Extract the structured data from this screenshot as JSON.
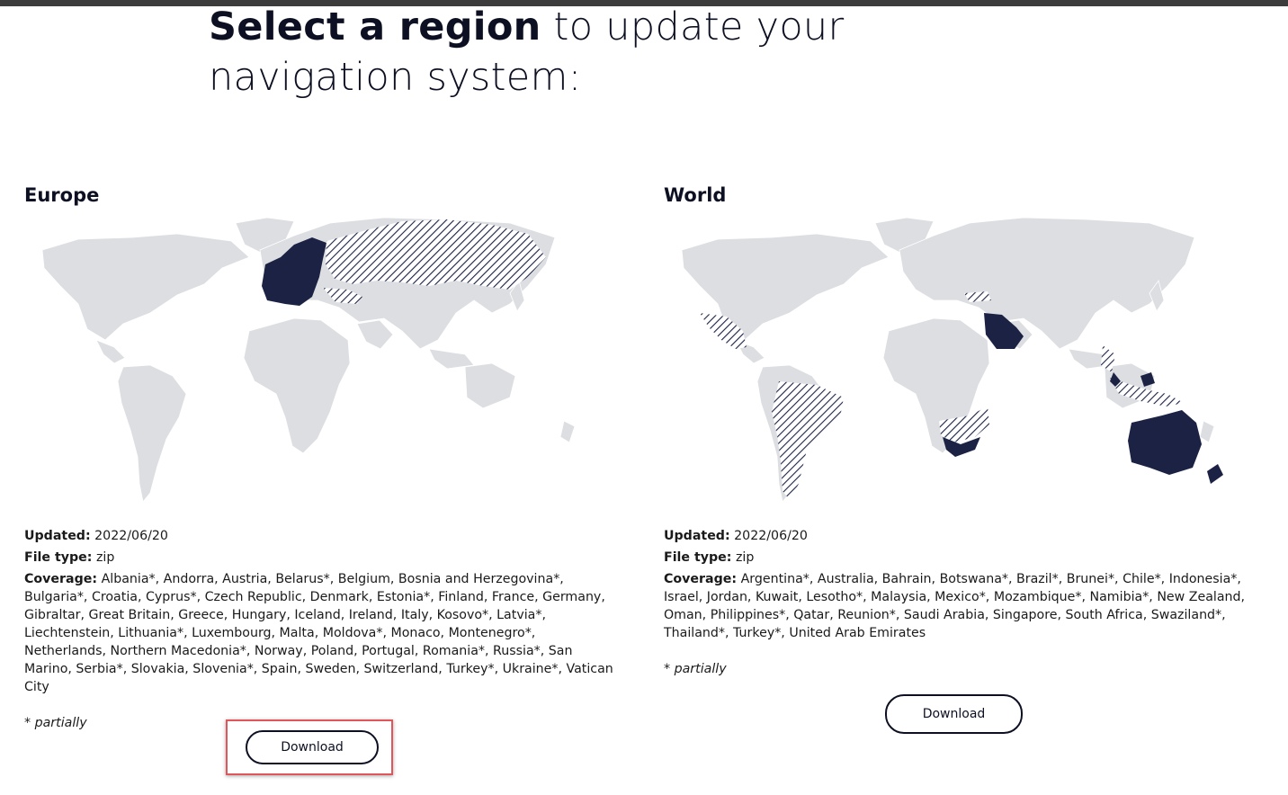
{
  "page": {
    "headline_bold": "Select a region",
    "headline_rest": " to update your navigation system:"
  },
  "regions": [
    {
      "name": "Europe",
      "updated_label": "Updated:",
      "updated": "2022/06/20",
      "filetype_label": "File type:",
      "filetype": "zip",
      "coverage_label": "Coverage:",
      "coverage": "Albania*, Andorra, Austria, Belarus*, Belgium, Bosnia and Herzegovina*, Bulgaria*, Croatia, Cyprus*, Czech Republic, Denmark, Estonia*, Finland, France, Germany, Gibraltar, Great Britain, Greece, Hungary, Iceland, Ireland, Italy, Kosovo*, Latvia*, Liechtenstein, Lithuania*, Luxembourg, Malta, Moldova*, Monaco, Montenegro*, Netherlands, Northern Macedonia*, Norway, Poland, Portugal, Romania*, Russia*, San Marino, Serbia*, Slovakia, Slovenia*, Spain, Sweden, Switzerland, Turkey*, Ukraine*, Vatican City",
      "note": "* partially",
      "button": "Download"
    },
    {
      "name": "World",
      "updated_label": "Updated:",
      "updated": "2022/06/20",
      "filetype_label": "File type:",
      "filetype": "zip",
      "coverage_label": "Coverage:",
      "coverage": "Argentina*, Australia, Bahrain, Botswana*, Brazil*, Brunei*, Chile*, Indonesia*, Israel, Jordan, Kuwait, Lesotho*, Malaysia, Mexico*, Mozambique*, Namibia*, New Zealand, Oman, Philippines*, Qatar, Reunion*, Saudi Arabia, Singapore, South Africa, Swaziland*, Thailand*, Turkey*, United Arab Emirates",
      "note": "* partially",
      "button": "Download"
    }
  ],
  "colors": {
    "covered": "#1b2244",
    "land": "#dcdee1",
    "highlight": "#e0565a"
  }
}
